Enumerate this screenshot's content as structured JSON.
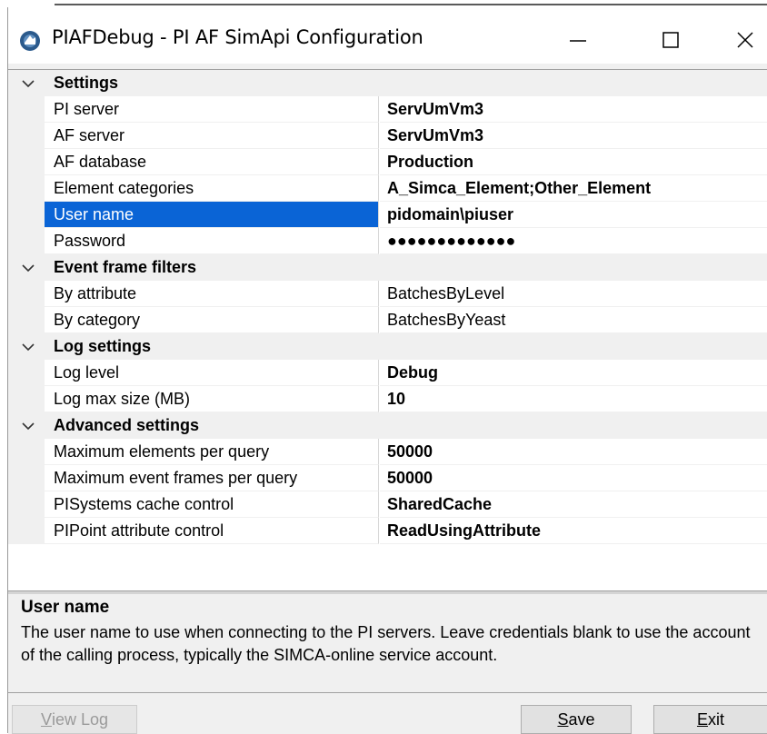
{
  "window": {
    "title": "PIAFDebug - PI AF SimApi Configuration",
    "controls": {
      "minimize": "minimize-icon",
      "maximize": "maximize-icon",
      "close": "close-icon"
    }
  },
  "sections": [
    {
      "label": "Settings",
      "props": [
        {
          "name": "PI server",
          "value": "ServUmVm3",
          "bold": true
        },
        {
          "name": "AF server",
          "value": "ServUmVm3",
          "bold": true
        },
        {
          "name": "AF database",
          "value": "Production",
          "bold": true
        },
        {
          "name": "Element categories",
          "value": "A_Simca_Element;Other_Element",
          "bold": true
        },
        {
          "name": "User name",
          "value": "pidomain\\piuser",
          "bold": true,
          "selected": true
        },
        {
          "name": "Password",
          "value": "●●●●●●●●●●●●●",
          "bold": true
        }
      ]
    },
    {
      "label": "Event frame filters",
      "props": [
        {
          "name": "By attribute",
          "value": "BatchesByLevel",
          "bold": false
        },
        {
          "name": "By category",
          "value": "BatchesByYeast",
          "bold": false
        }
      ]
    },
    {
      "label": "Log settings",
      "props": [
        {
          "name": "Log level",
          "value": "Debug",
          "bold": true
        },
        {
          "name": "Log max size (MB)",
          "value": "10",
          "bold": true
        }
      ]
    },
    {
      "label": "Advanced settings",
      "props": [
        {
          "name": "Maximum elements per query",
          "value": "50000",
          "bold": true
        },
        {
          "name": "Maximum event frames per query",
          "value": "50000",
          "bold": true
        },
        {
          "name": "PISystems cache control",
          "value": "SharedCache",
          "bold": true
        },
        {
          "name": "PIPoint attribute control",
          "value": "ReadUsingAttribute",
          "bold": true
        }
      ]
    }
  ],
  "help": {
    "title": "User name",
    "text": "The user name to use when connecting to the PI servers. Leave credentials blank to use the account of the calling process, typically the SIMCA-online service account."
  },
  "buttons": {
    "view_log": {
      "mnemonic": "V",
      "rest": "iew Log"
    },
    "save": {
      "mnemonic": "S",
      "rest": "ave"
    },
    "exit": {
      "mnemonic": "E",
      "rest": "xit"
    }
  },
  "colors": {
    "selection": "#0a64d6",
    "category_bg": "#f0f0f0",
    "grid_bg": "#ffffff",
    "app_icon": "#2b5a8c"
  }
}
